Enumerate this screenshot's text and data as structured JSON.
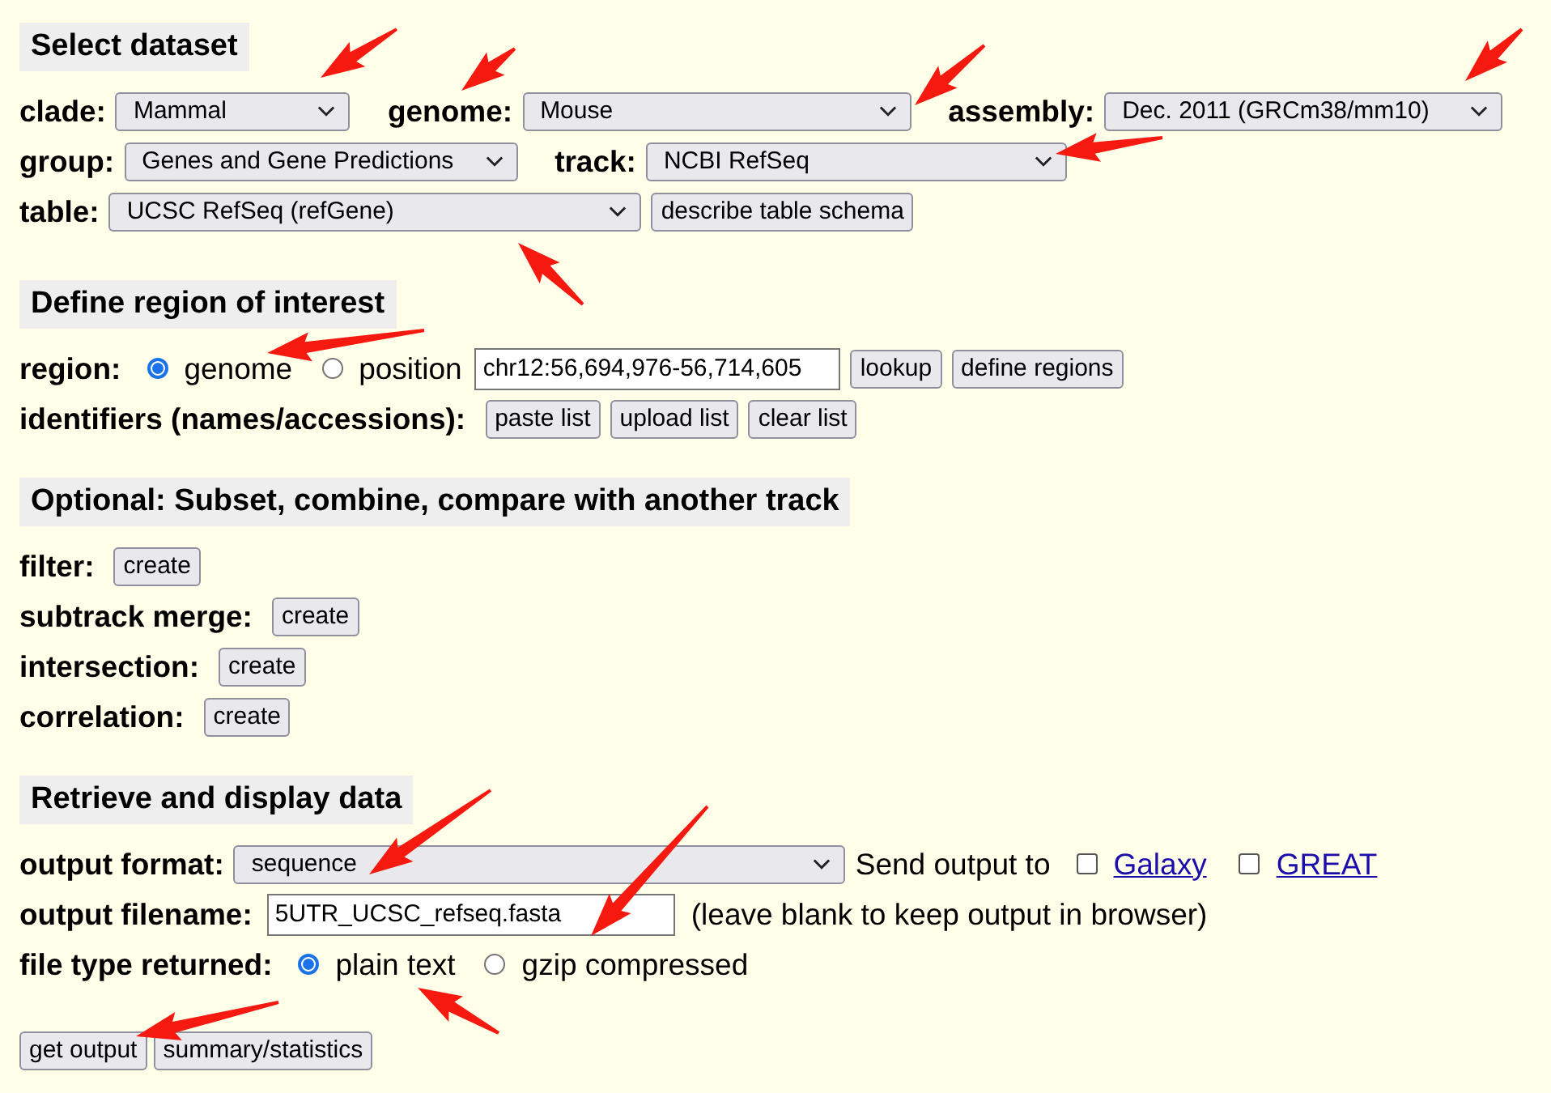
{
  "select_dataset": {
    "title": "Select dataset",
    "clade": {
      "label": "clade:",
      "value": "Mammal"
    },
    "genome": {
      "label": "genome:",
      "value": "Mouse"
    },
    "assembly": {
      "label": "assembly:",
      "value": "Dec. 2011 (GRCm38/mm10)"
    },
    "group": {
      "label": "group:",
      "value": "Genes and Gene Predictions"
    },
    "track": {
      "label": "track:",
      "value": "NCBI RefSeq"
    },
    "table": {
      "label": "table:",
      "value": "UCSC RefSeq (refGene)"
    },
    "describe_button": "describe table schema"
  },
  "define_region": {
    "title": "Define region of interest",
    "region": {
      "label": "region:",
      "options": [
        {
          "label": "genome",
          "selected": true
        },
        {
          "label": "position",
          "selected": false
        }
      ],
      "position_value": "chr12:56,694,976-56,714,605",
      "buttons": [
        "lookup",
        "define regions"
      ]
    },
    "identifiers": {
      "label": "identifiers (names/accessions):",
      "buttons": [
        "paste list",
        "upload list",
        "clear list"
      ]
    }
  },
  "optional": {
    "title": "Optional: Subset, combine, compare with another track",
    "rows": [
      {
        "label": "filter:",
        "button": "create"
      },
      {
        "label": "subtrack merge:",
        "button": "create"
      },
      {
        "label": "intersection:",
        "button": "create"
      },
      {
        "label": "correlation:",
        "button": "create"
      }
    ]
  },
  "retrieve": {
    "title": "Retrieve and display data",
    "output_format": {
      "label": "output format:",
      "value": "sequence"
    },
    "send_output_label": "Send output to",
    "destinations": [
      {
        "label": "Galaxy",
        "checked": false
      },
      {
        "label": "GREAT",
        "checked": false
      }
    ],
    "output_filename": {
      "label": "output filename:",
      "value": "5UTR_UCSC_refseq.fasta",
      "note": "(leave blank to keep output in browser)"
    },
    "file_type": {
      "label": "file type returned:",
      "options": [
        {
          "label": "plain text",
          "selected": true
        },
        {
          "label": "gzip compressed",
          "selected": false
        }
      ]
    },
    "buttons": [
      "get output",
      "summary/statistics"
    ]
  }
}
